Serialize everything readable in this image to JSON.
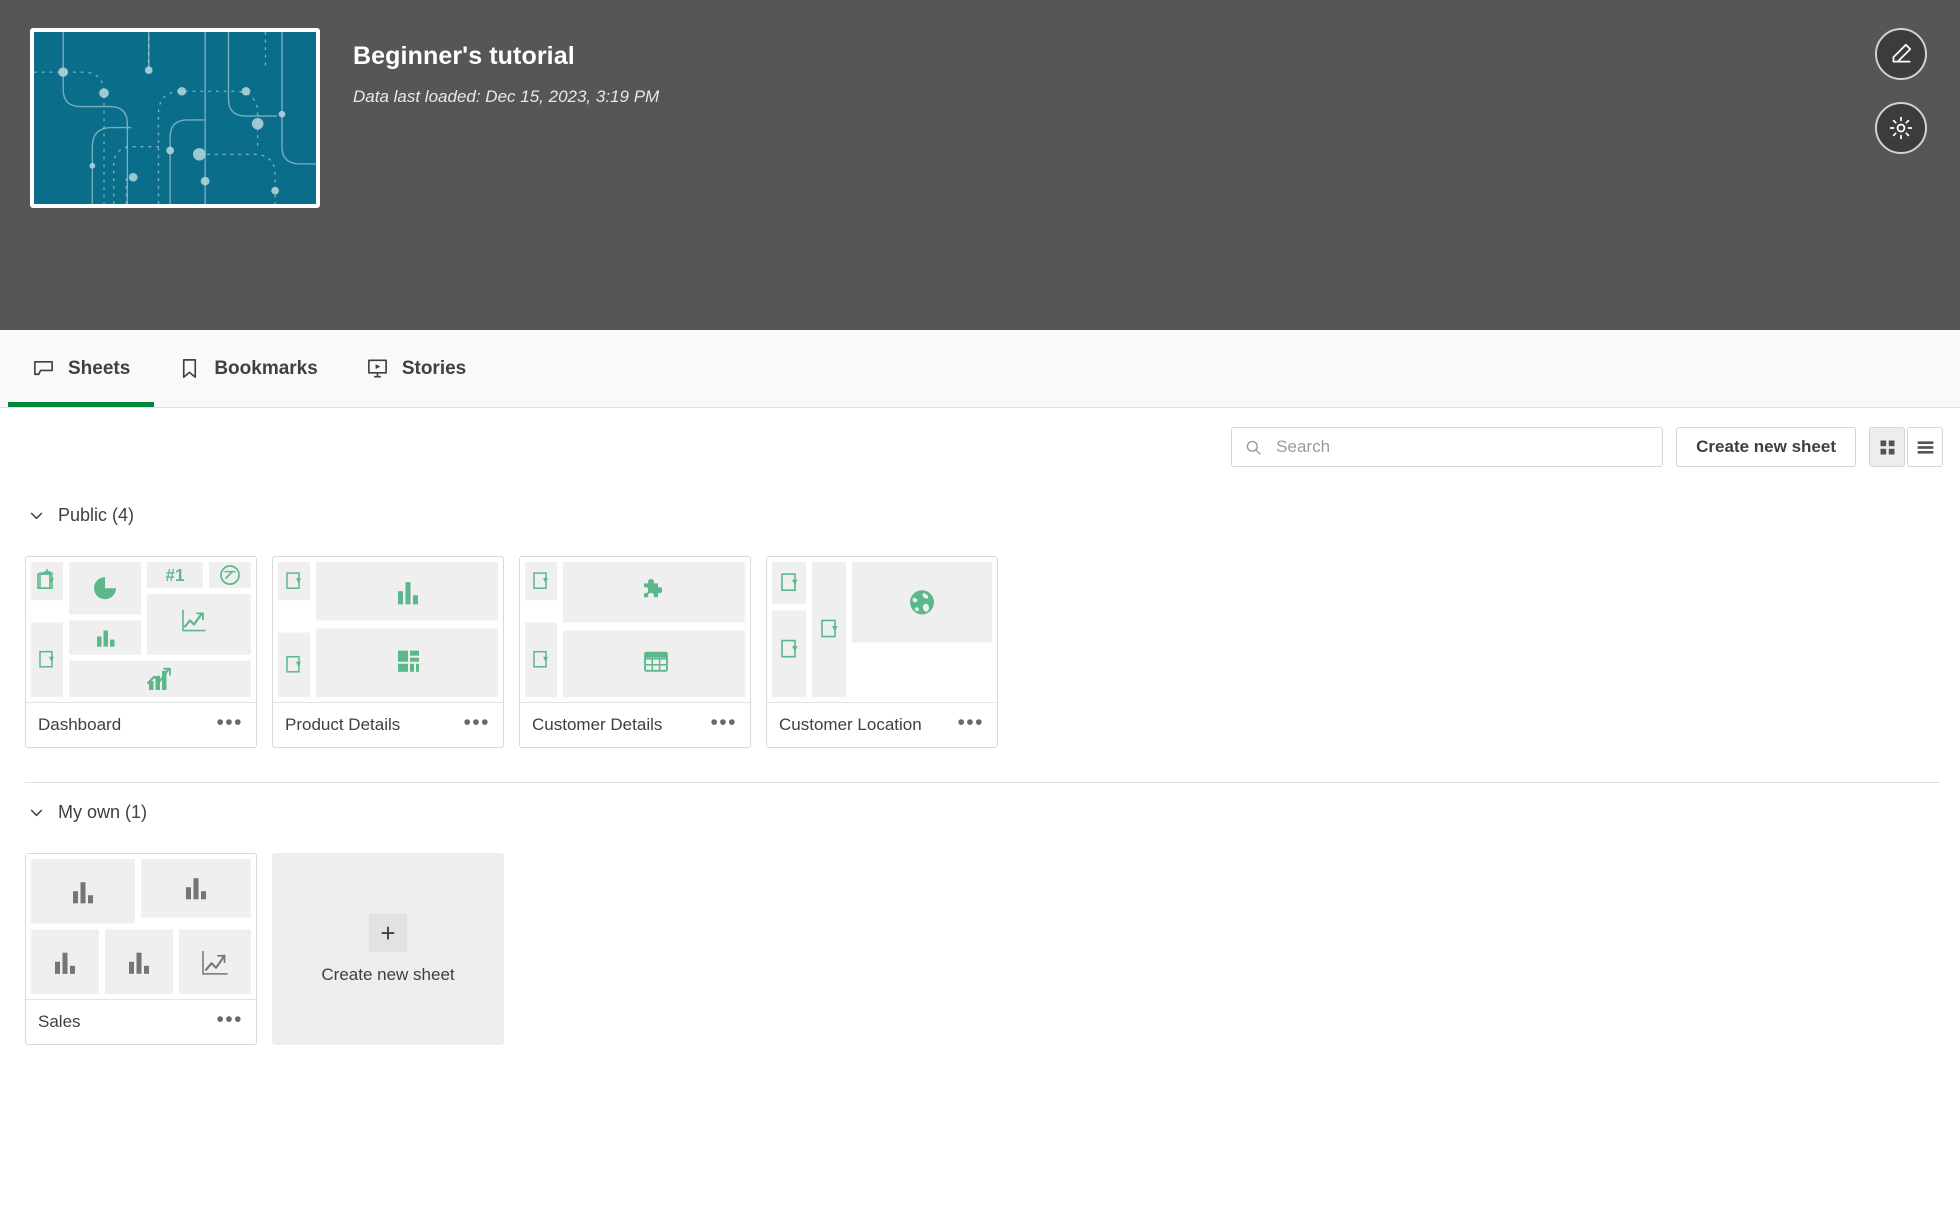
{
  "header": {
    "app_title": "Beginner's tutorial",
    "data_last_loaded": "Data last loaded: Dec 15, 2023, 3:19 PM",
    "thumbnail_color": "#0a6e8a",
    "background_color": "#565656",
    "actions": [
      {
        "name": "edit-app-button",
        "icon": "pencil-icon",
        "tooltip": "Edit"
      },
      {
        "name": "app-settings-button",
        "icon": "gear-icon",
        "tooltip": "Settings"
      }
    ]
  },
  "tabs": [
    {
      "label": "Sheets",
      "icon": "sheet-icon",
      "active": true
    },
    {
      "label": "Bookmarks",
      "icon": "bookmark-icon",
      "active": false
    },
    {
      "label": "Stories",
      "icon": "story-icon",
      "active": false
    }
  ],
  "toolbar": {
    "search_placeholder": "Search",
    "search_value": "",
    "create_new_sheet_label": "Create new sheet",
    "grid_view_active": true,
    "list_view_active": false
  },
  "accent": {
    "active_tab_green": "#00873d",
    "published_icon_green": "#5cb78b",
    "private_icon_gray": "#757575"
  },
  "sections": [
    {
      "title": "Public (4)",
      "expanded": true,
      "sheets": [
        {
          "name": "Dashboard",
          "layout": "dashboard",
          "published": true
        },
        {
          "name": "Product Details",
          "layout": "product",
          "published": true
        },
        {
          "name": "Customer Details",
          "layout": "customer",
          "published": true
        },
        {
          "name": "Customer Location",
          "layout": "location",
          "published": true
        }
      ]
    },
    {
      "title": "My own (1)",
      "expanded": true,
      "sheets": [
        {
          "name": "Sales",
          "layout": "sales",
          "published": false
        }
      ],
      "create_tile": {
        "label": "Create new sheet",
        "glyph": "+"
      }
    }
  ]
}
